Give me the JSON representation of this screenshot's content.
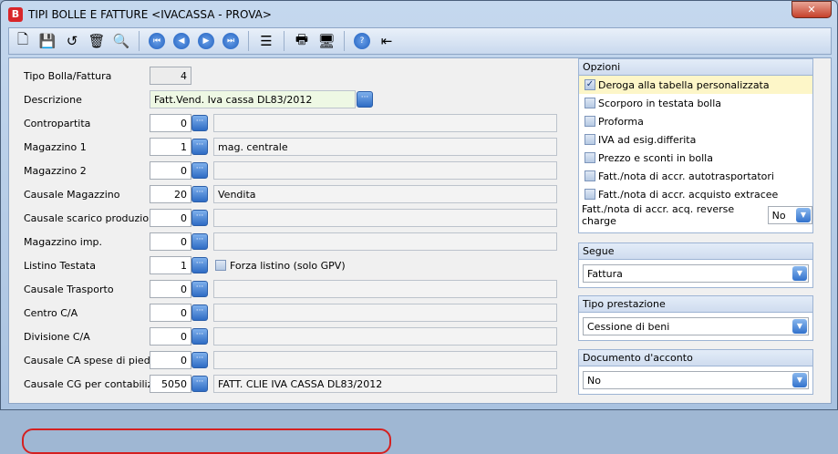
{
  "window": {
    "title": "TIPI BOLLE E FATTURE <IVACASSA - PROVA>",
    "close": "✕"
  },
  "toolbar": [
    "new-icon",
    "save-icon",
    "undo-icon",
    "delete-icon",
    "find-icon",
    "first-icon",
    "prev-icon",
    "next-icon",
    "last-icon",
    "list-icon",
    "print-icon",
    "preview-icon",
    "help-icon",
    "exit-icon"
  ],
  "fields": [
    {
      "label": "Tipo Bolla/Fattura",
      "value": "4"
    },
    {
      "label": "Descrizione",
      "value": "Fatt.Vend. Iva cassa DL83/2012"
    },
    {
      "label": "Contropartita",
      "value": "0",
      "desc": ""
    },
    {
      "label": "Magazzino 1",
      "value": "1",
      "desc": "mag. centrale"
    },
    {
      "label": "Magazzino 2",
      "value": "0",
      "desc": ""
    },
    {
      "label": "Causale Magazzino",
      "value": "20",
      "desc": "Vendita"
    },
    {
      "label": "Causale scarico produzione",
      "value": "0",
      "desc": ""
    },
    {
      "label": "Magazzino imp.",
      "value": "0",
      "desc": ""
    },
    {
      "label": "Listino Testata",
      "value": "1",
      "check": "Forza listino (solo GPV)"
    },
    {
      "label": "Causale Trasporto",
      "value": "0",
      "desc": ""
    },
    {
      "label": "Centro C/A",
      "value": "0",
      "desc": ""
    },
    {
      "label": "Divisione C/A",
      "value": "0",
      "desc": ""
    },
    {
      "label": "Causale CA spese di piede",
      "value": "0",
      "desc": ""
    },
    {
      "label": "Causale CG per contabilizz.",
      "value": "5050",
      "desc": "FATT. CLIE IVA CASSA DL83/2012"
    }
  ],
  "opzioni": {
    "title": "Opzioni",
    "items": [
      {
        "label": "Deroga alla tabella personalizzata",
        "checked": true
      },
      {
        "label": "Scorporo in testata bolla",
        "checked": false
      },
      {
        "label": "Proforma",
        "checked": false
      },
      {
        "label": "IVA ad esig.differita",
        "checked": false
      },
      {
        "label": "Prezzo e sconti in bolla",
        "checked": false
      },
      {
        "label": "Fatt./nota di accr. autotrasportatori",
        "checked": false
      },
      {
        "label": "Fatt./nota di accr. acquisto extracee",
        "checked": false
      }
    ],
    "reverse_label": "Fatt./nota di accr. acq. reverse charge",
    "reverse_value": "No"
  },
  "segue": {
    "title": "Segue",
    "value": "Fattura"
  },
  "tipo_prestazione": {
    "title": "Tipo prestazione",
    "value": "Cessione di beni"
  },
  "documento_acconto": {
    "title": "Documento d'acconto",
    "value": "No"
  }
}
